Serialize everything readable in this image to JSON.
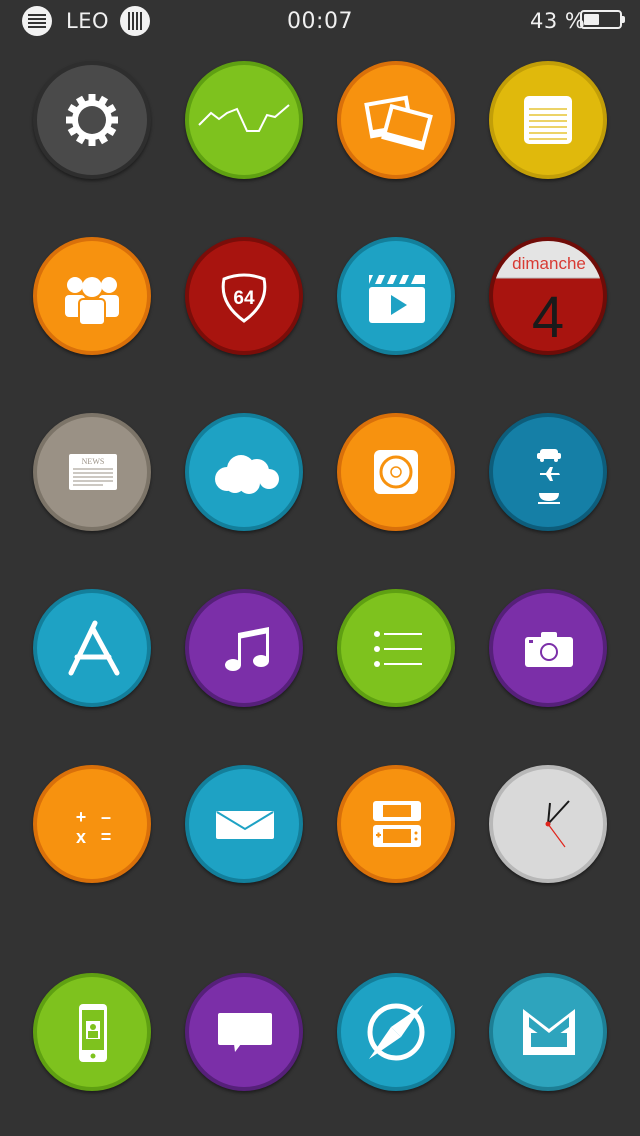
{
  "status_bar": {
    "carrier": "LEO",
    "time": "00:07",
    "battery_text": "43 %",
    "battery_level": 0.43
  },
  "calendar": {
    "day_name": "dimanche",
    "day_number": "4"
  },
  "news": {
    "label": "NEWS"
  },
  "route": {
    "number": "64"
  },
  "calculator": {
    "plus": "+",
    "minus": "–",
    "times": "x",
    "equals": "="
  },
  "colors": {
    "background": "#333333",
    "gray": "#4a4a4a",
    "green": "#7ec21e",
    "orange": "#f7920f",
    "yellow": "#e0b90c",
    "red": "#a8140f",
    "blue": "#1ea2c4",
    "beige": "#9a9185",
    "purple": "#7b2fa8",
    "clock": "#d9d9d9"
  },
  "apps": [
    {
      "id": "settings",
      "icon": "gear-icon"
    },
    {
      "id": "stocks",
      "icon": "stock-chart-icon"
    },
    {
      "id": "photos",
      "icon": "photos-icon"
    },
    {
      "id": "notes",
      "icon": "notepad-icon"
    },
    {
      "id": "contacts",
      "icon": "people-icon"
    },
    {
      "id": "route-64",
      "icon": "highway-shield-icon"
    },
    {
      "id": "videos",
      "icon": "clapperboard-icon"
    },
    {
      "id": "calendar",
      "icon": "calendar-icon"
    },
    {
      "id": "newsstand",
      "icon": "newspaper-icon"
    },
    {
      "id": "weather",
      "icon": "cloud-icon"
    },
    {
      "id": "music-player",
      "icon": "ipod-icon"
    },
    {
      "id": "travel",
      "icon": "travel-icon"
    },
    {
      "id": "app-store",
      "icon": "app-store-icon"
    },
    {
      "id": "music",
      "icon": "music-note-icon"
    },
    {
      "id": "reminders",
      "icon": "list-icon"
    },
    {
      "id": "camera",
      "icon": "camera-icon"
    },
    {
      "id": "calculator",
      "icon": "calculator-icon"
    },
    {
      "id": "mail",
      "icon": "envelope-icon"
    },
    {
      "id": "game-console",
      "icon": "game-console-icon"
    },
    {
      "id": "clock",
      "icon": "clock-icon"
    },
    {
      "id": "find-my-iphone",
      "icon": "phone-icon"
    },
    {
      "id": "messages",
      "icon": "speech-bubble-icon"
    },
    {
      "id": "safari",
      "icon": "compass-icon"
    },
    {
      "id": "mailbox",
      "icon": "inbox-tray-icon"
    }
  ]
}
